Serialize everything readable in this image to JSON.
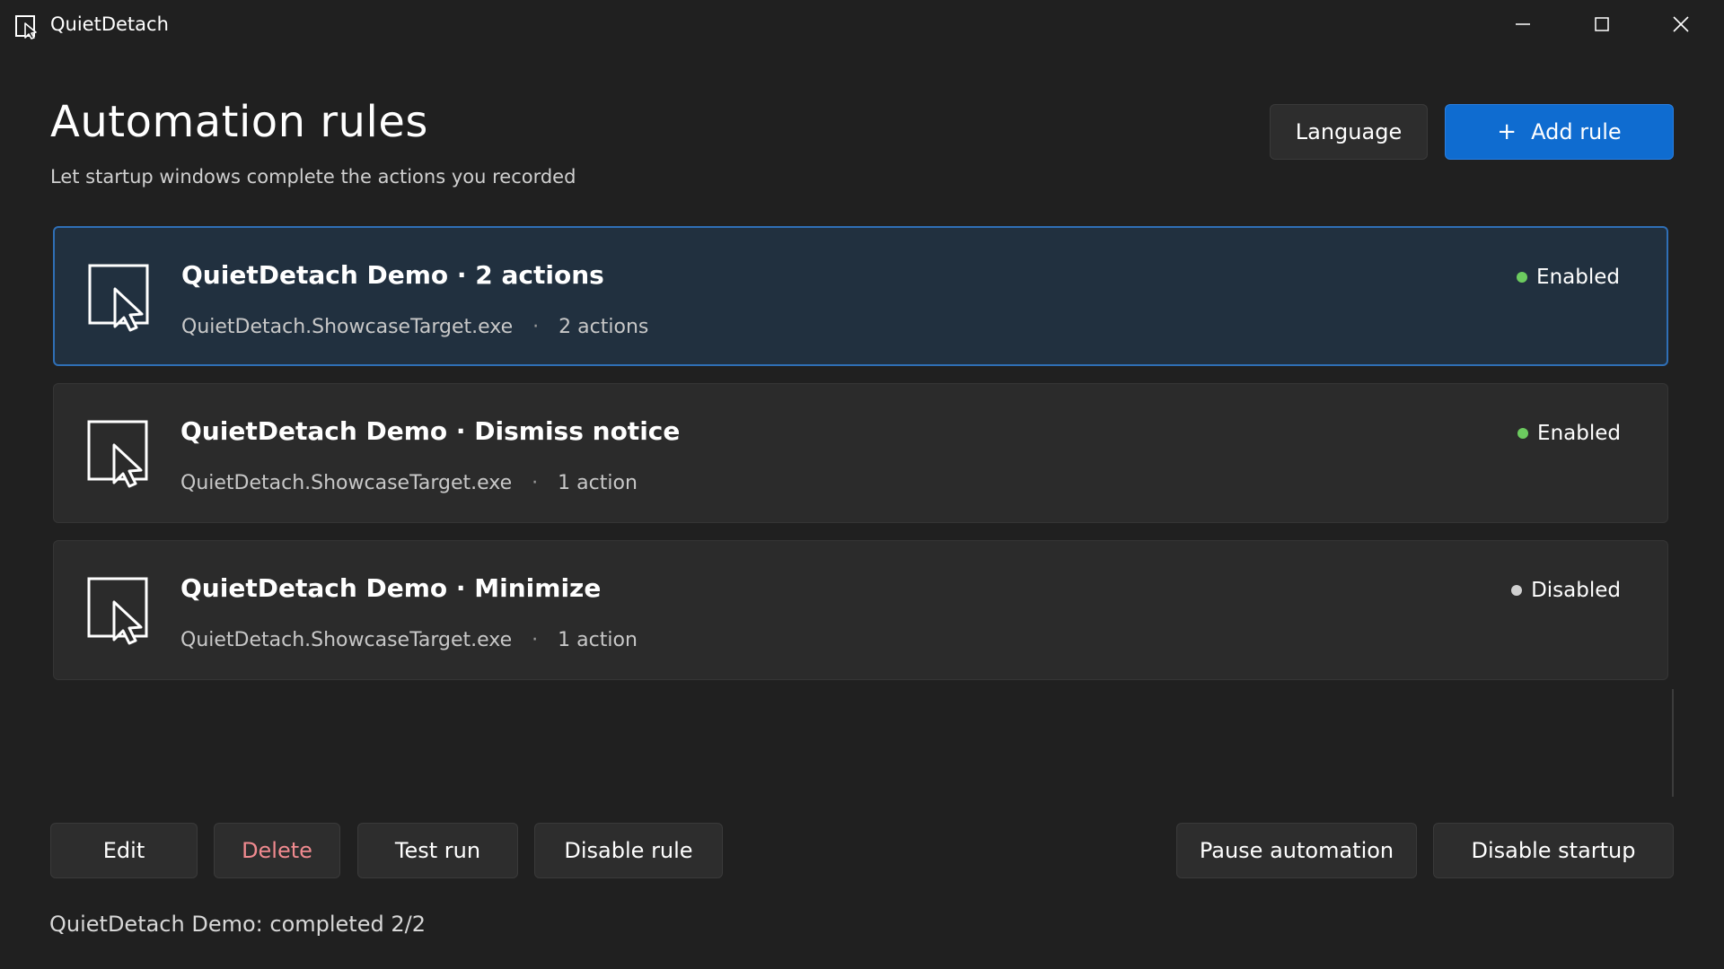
{
  "window": {
    "title": "QuietDetach",
    "icon": "window-cursor-icon",
    "controls": [
      "minimize-icon",
      "maximize-icon",
      "close-icon"
    ]
  },
  "header": {
    "title": "Automation rules",
    "subtitle": "Let startup windows complete the actions you recorded",
    "language_label": "Language",
    "add_rule_label": "Add rule",
    "add_rule_icon": "+"
  },
  "rules": [
    {
      "title": "QuietDetach Demo · 2 actions",
      "exe": "QuietDetach.ShowcaseTarget.exe",
      "separator": "·",
      "actions": "2 actions",
      "status": "Enabled",
      "status_color": "#6ccb5f",
      "selected": true
    },
    {
      "title": "QuietDetach Demo · Dismiss notice",
      "exe": "QuietDetach.ShowcaseTarget.exe",
      "separator": "·",
      "actions": "1 action",
      "status": "Enabled",
      "status_color": "#6ccb5f",
      "selected": false
    },
    {
      "title": "QuietDetach Demo · Minimize",
      "exe": "QuietDetach.ShowcaseTarget.exe",
      "separator": "·",
      "actions": "1 action",
      "status": "Disabled",
      "status_color": "#d0d0d0",
      "selected": false
    }
  ],
  "actions": {
    "edit": "Edit",
    "delete": "Delete",
    "test_run": "Test run",
    "disable_rule": "Disable rule",
    "pause_automation": "Pause automation",
    "disable_startup": "Disable startup"
  },
  "status_text": "QuietDetach Demo: completed 2/2",
  "colors": {
    "background": "#202020",
    "accent": "#0f6cd0",
    "selected_card": "#21303f",
    "delete_text": "#f08a8f"
  }
}
